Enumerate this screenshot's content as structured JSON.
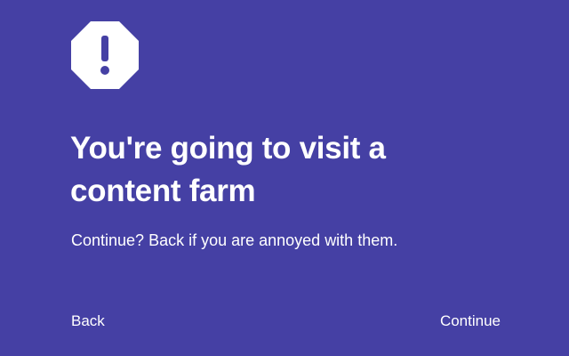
{
  "icon": "warning-octagon-icon",
  "colors": {
    "background": "#4540a4",
    "foreground": "#ffffff"
  },
  "title": {
    "line1": "You're going to visit a",
    "line2": "content farm"
  },
  "message": "Continue? Back if you are annoyed with them.",
  "actions": {
    "back_label": "Back",
    "continue_label": "Continue"
  }
}
